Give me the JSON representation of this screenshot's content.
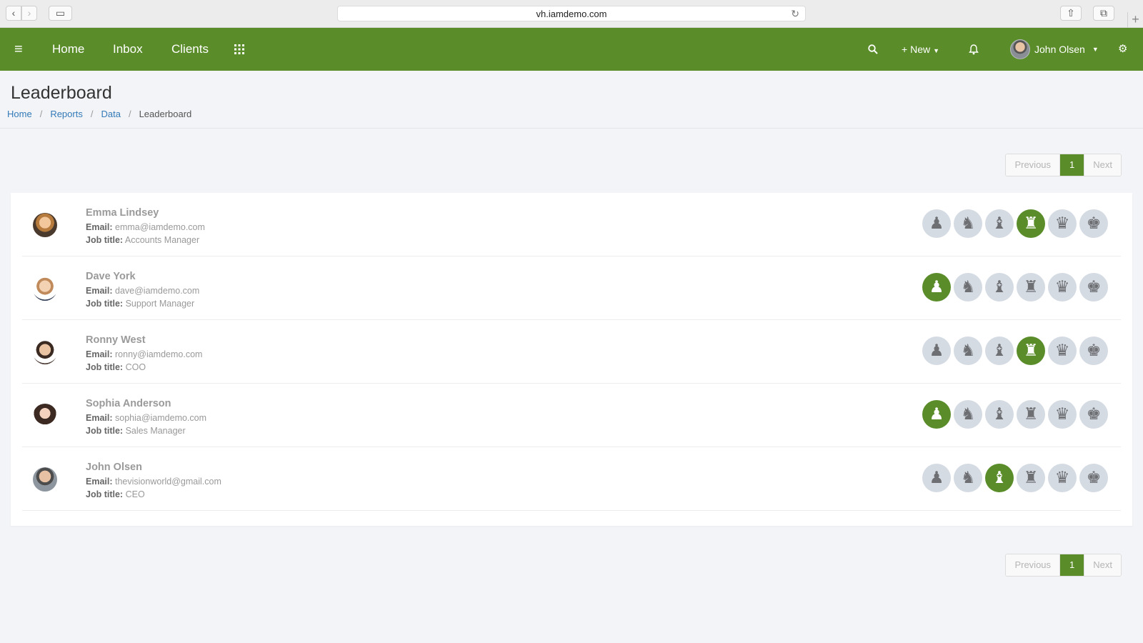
{
  "browser": {
    "url": "vh.iamdemo.com",
    "back_icon": "‹",
    "forward_icon": "›"
  },
  "navbar": {
    "menu_icon": "≡",
    "items": [
      {
        "label": "Home"
      },
      {
        "label": "Inbox"
      },
      {
        "label": "Clients"
      }
    ],
    "apps_icon": "⋮⋮⋮",
    "new_label": "New",
    "user_name": "John Olsen",
    "color": "#5a8d2a"
  },
  "page": {
    "title": "Leaderboard",
    "breadcrumb": [
      "Home",
      "Reports",
      "Data",
      "Leaderboard"
    ]
  },
  "pagination": {
    "previous": "Previous",
    "page": "1",
    "next": "Next"
  },
  "labels": {
    "email": "Email:",
    "job_title": "Job title:"
  },
  "badge_icons": [
    "chess-pawn-icon",
    "chess-knight-icon",
    "chess-bishop-icon",
    "chess-rook-icon",
    "chess-queen-icon",
    "chess-king-icon"
  ],
  "leaderboard": [
    {
      "name": "Emma Lindsey",
      "email": "emma@iamdemo.com",
      "job_title": "Accounts Manager",
      "active_badge": "rook"
    },
    {
      "name": "Dave York",
      "email": "dave@iamdemo.com",
      "job_title": "Support Manager",
      "active_badge": "pawn"
    },
    {
      "name": "Ronny West",
      "email": "ronny@iamdemo.com",
      "job_title": "COO",
      "active_badge": "rook"
    },
    {
      "name": "Sophia Anderson",
      "email": "sophia@iamdemo.com",
      "job_title": "Sales Manager",
      "active_badge": "pawn"
    },
    {
      "name": "John Olsen",
      "email": "thevisionworld@gmail.com",
      "job_title": "CEO",
      "active_badge": "bishop"
    }
  ]
}
